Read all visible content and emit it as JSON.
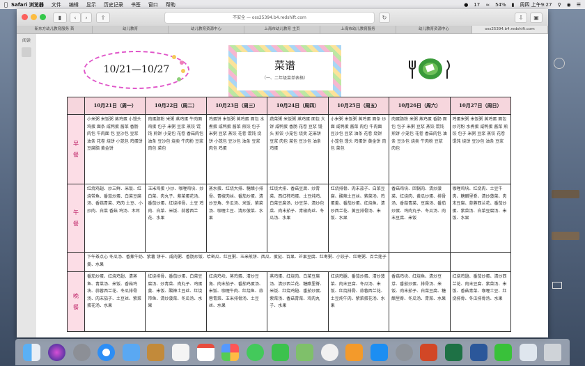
{
  "menubar": {
    "app_name": "Safari 浏览器",
    "items": [
      "文件",
      "编辑",
      "显示",
      "历史记录",
      "书签",
      "窗口",
      "帮助"
    ],
    "battery": "54%",
    "clock": "周四 上午9:27",
    "count": "17"
  },
  "browser": {
    "url": "不安全 — oss25394.b4.redshift.com",
    "tabs": [
      "新东方幼儿教育服务 首",
      "幼儿教育",
      "幼儿教育资源中心",
      "上海市幼儿教育 主页",
      "上海市幼儿教育服务",
      "幼儿教育资源中心",
      "oss25394.b4.redshift.com"
    ],
    "active_tab": 6,
    "sidebar_label": "阅读"
  },
  "page": {
    "dates": "10/21—10/27",
    "title": "菜谱",
    "subtitle": "（一、二年级菜单表格）"
  },
  "table": {
    "headers": [
      "",
      "10月21日（周一）",
      "10月22日（周二）",
      "10月23日（周三）",
      "10月24日（周四）",
      "10月25日（周五）",
      "10月26日（周六）",
      "10月27日（周日）"
    ],
    "breakfast_label": "早\n餐",
    "breakfast": [
      "小米粥 米饭粥 蒸鸡蛋 小馒头 鸡蛋 面条 咸鸭蛋 酱菜 香肠 肉包 牛肉面 包 豆沙包 豆浆 油条 花卷 烧饼 小笼包 鸡蛋饼 豆腐脑 黄金饼",
      "肉蛋肠粉 米粥 蒸鸡蛋 牛肉面 鸡蛋 包子 米粥 豆浆 蒸饺 馄饨 煎饼 小笼包 花卷 香菇肉包 油条 豆沙包 烧卖 牛肉粉 豆浆 肉包 菜包",
      "鸡蛋饼 米饭粥 蒸鸡蛋 面包 水煮蛋 咸鸭蛋 酱菜 煎饺 包子 米粥 豆浆 蒸饺 花卷 馄饨 烧饼 小笼包 豆沙包 油条 豆浆 肉包 鸡蛋",
      "蔬菜粥 米饭粥 蒸鸡蛋 面包 大饼 咸鸭蛋 香肠 花卷 豆浆 馒头 煎饺 小笼包 烧卖 芝麻饼 豆浆 肉包 菜包 豆沙包 油条 鸡蛋",
      "小米粥 米饭粥 蒸鸡蛋 面条 炒面 咸鸭蛋 酱菜 肉包 牛肉面 豆沙包 豆浆 油条 花卷 烧饼 小笼包 馒头 鸡蛋饼 黄金饼 肉包 菜包",
      "肉蛋肠粉 米粥 蒸鸡蛋 香肠 面包 包子 米粥 豆浆 蒸饺 馄饨 煎饼 小笼包 花卷 香菇肉包 油条 豆沙包 烧卖 牛肉粉 豆浆 肉包",
      "鸡蛋米粥 米饭粥 蒸鸡蛋 面包 炒河粉 水煮蛋 咸鸭蛋 酱菜 煎饺 包子 米粥 豆浆 蒸饺 花卷 馄饨 烧饼 豆沙包 油条 豆浆"
    ],
    "lunch_label": "午\n餐",
    "lunch": [
      "红烧鸡翅、炒三鲜、米饭、红烧带鱼、番茄炒蛋、白菜豆腐汤、香菇青菜、鸡肉 土豆、小炒肉、白菜 香菇 鸡汤、木耳",
      "玉米鸡蛋 小炒、咖喱鸡块、炒白菜、肉丸子、紫菜蛋花汤、番茄炒蛋、红烧排骨、土豆 鸡肉、白菜、米饭、蒜蓉西兰花、水果",
      "蒸水蛋、红烧大排、糖醋小排骨、青椒肉丝、番茄炒蛋、清炒豆角、冬瓜汤、米饭、紫菜汤、咖喱土豆、清炒菠菜、水果",
      "红烧大排、香菇豆腐、炒青菜、西红柿鸡蛋、土豆炖鸡、白菜豆腐汤、炒豆芽、清炒包菜、肉末茄子、青椒肉丝、冬瓜汤、水果",
      "红烧排骨、肉末茄子、白菜豆腐、酸辣土豆丝、紫菜汤、鸡蛋羹、番茄炒蛋、红烧鱼、清炒西兰花、黄豆排骨汤、米饭、水果",
      "香菇鸡块、回锅肉、清炒菠菜、红烧肉、黄瓜炒蛋、排骨汤、香菇青菜、豆腐汤、番茄炒蛋、鸡肉丸子、冬瓜汤、肉末豆腐、米饭",
      "咖喱鸡块、红烧肉、土豆牛肉、糖醋里脊、清炒菠菜、肉末豆腐、蒜蓉西兰花、番茄炒蛋、紫菜汤、白菜豆腐汤、米饭、水果"
    ],
    "snack_label": "",
    "snack": "下午茶点心 冬瓜汤、香蕉牛奶、紫薯 饼干、咸肉粥、香肠炒饭、哈密瓜、红豆粥、玉米煎饼、西瓜、蛋挞、百果、芒果豆腐、红枣粥、小饺子、红枣粥、百合莲子羹、水果",
    "dinner_label": "晚\n餐",
    "dinner": [
      "番茄炒蛋、红烧鸡翅、清蒸鱼、青菜汤、米饭、香菇鸡块、蒜蓉西兰花、冬瓜排骨汤、肉末茄子、土豆丝、紫菜蛋花汤、水果",
      "红烧排骨、番茄炒蛋、白菜豆腐汤、炒青菜、肉丸子、鸡蛋羹、米饭、酸辣土豆丝、红烧带鱼、清炒菠菜、冬瓜汤、水果",
      "红烧鸡块、蒸鸡蛋、清炒豆角、肉末茄子、番茄鸡蛋汤、米饭、咖喱牛肉、红烧鱼、蒜蓉青菜、玉米排骨汤、土豆丝、水果",
      "蒸鸡蛋、红烧肉、白菜豆腐汤、清炒西兰花、糖醋里脊、米饭、红烧鸡翅、番茄炒蛋、紫菜汤、香菇青菜、鸡肉丸子、水果",
      "红烧鸡腿、番茄炒蛋、清炒菠菜、肉末豆腐、冬瓜汤、米饭、红烧排骨、蒜蓉西兰花、土豆炖牛肉、紫菜蛋花汤、水果",
      "香菇鸡块、红烧鱼、清炒豆芽、番茄炒蛋、排骨汤、米饭、肉末茄子、白菜豆腐、糖醋里脊、冬瓜汤、青菜、水果",
      "红烧鸡翅、番茄炒蛋、清炒西兰花、肉末豆腐、紫菜汤、米饭、香菇青菜、咖喱土豆、红烧排骨、冬瓜排骨汤、水果"
    ]
  },
  "dock": {
    "apps": [
      "finder",
      "siri",
      "launchpad",
      "safari",
      "mail",
      "notes",
      "reminders",
      "calendar",
      "photos",
      "messages",
      "facetime",
      "maps",
      "itunes",
      "ibooks",
      "appstore",
      "settings",
      "powerpoint",
      "excel",
      "word",
      "wechat",
      "preview",
      "trash"
    ]
  },
  "colors": {
    "header_pink": "#f6d6dd",
    "meal_pink": "#fcdde6",
    "meal_text": "#c0266a",
    "oval": "#e056c9"
  }
}
